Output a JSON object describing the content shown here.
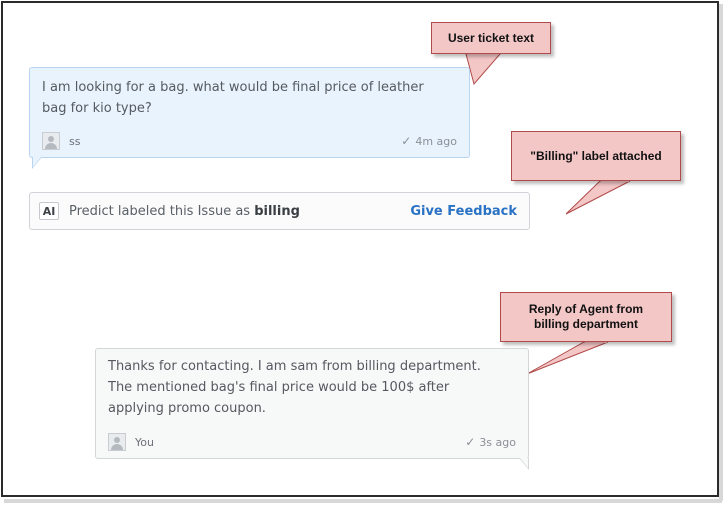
{
  "ticket": {
    "message": "I am looking for a bag. what would be final price of leather bag for kio type?",
    "author": "ss",
    "time": "4m ago"
  },
  "ai_prediction": {
    "badge": "AI",
    "text_prefix": "Predict labeled this Issue as ",
    "label": "billing",
    "feedback_link": "Give Feedback"
  },
  "reply": {
    "message": "Thanks for contacting. I am sam from billing department. The mentioned bag's final price would be 100$ after applying promo coupon.",
    "author": "You",
    "time": "3s ago"
  },
  "callouts": {
    "ticket": "User ticket text",
    "billing": "\"Billing\" label attached",
    "reply": "Reply of Agent from billing department"
  },
  "colors": {
    "ticket_bubble_bg": "#e9f3fd",
    "reply_bubble_bg": "#f7f8f8",
    "callout_bg": "#f4c7c7",
    "callout_border": "#b14a4a",
    "link": "#2a72c4"
  }
}
